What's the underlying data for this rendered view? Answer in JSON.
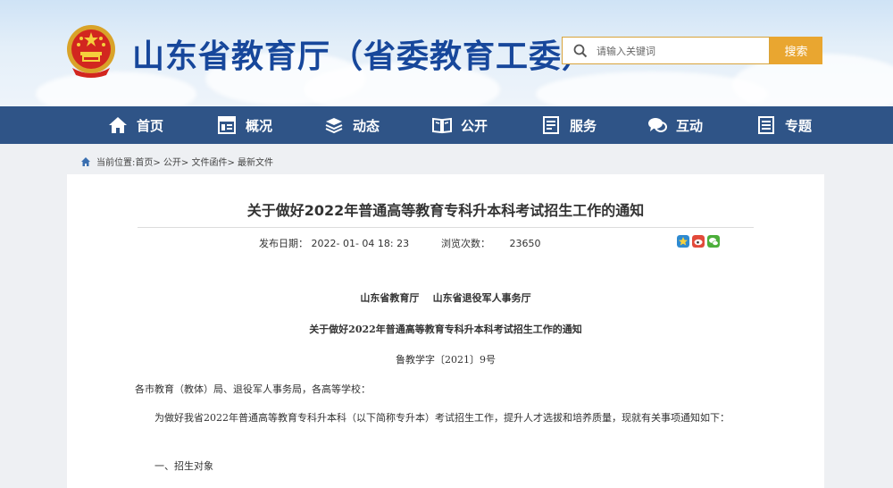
{
  "header": {
    "site_title": "山东省教育厅（省委教育工委）",
    "search_placeholder": "请输入关键词",
    "search_button": "搜索"
  },
  "nav": {
    "items": [
      {
        "label": "首页",
        "icon": "home-icon"
      },
      {
        "label": "概况",
        "icon": "overview-icon"
      },
      {
        "label": "动态",
        "icon": "news-icon"
      },
      {
        "label": "公开",
        "icon": "book-icon"
      },
      {
        "label": "服务",
        "icon": "service-icon"
      },
      {
        "label": "互动",
        "icon": "chat-icon"
      },
      {
        "label": "专题",
        "icon": "topic-icon"
      }
    ]
  },
  "breadcrumb": {
    "prefix": "当前位置:",
    "trail": "首页> 公开> 文件函件> 最新文件"
  },
  "article": {
    "title": "关于做好2022年普通高等教育专科升本科考试招生工作的通知",
    "date_label": "发布日期：",
    "date_value": "2022- 01- 04 18: 23",
    "views_label": "浏览次数：",
    "views_value": "23650",
    "share_icons": [
      "qzone-share-icon",
      "weibo-share-icon",
      "wechat-share-icon"
    ],
    "issuers": "山东省教育厅    山东省退役军人事务厅",
    "doc_title": "关于做好2022年普通高等教育专科升本科考试招生工作的通知",
    "doc_number": "鲁教学字〔2021〕9号",
    "salutation": "各市教育（教体）局、退役军人事务局，各高等学校：",
    "para1": "为做好我省2022年普通高等教育专科升本科（以下简称专升本）考试招生工作，提升人才选拔和培养质量，现就有关事项通知如下：",
    "section1": "一、招生对象"
  },
  "colors": {
    "title_blue": "#17479b",
    "nav_bg": "#2f5487",
    "search_orange": "#e9a630"
  }
}
